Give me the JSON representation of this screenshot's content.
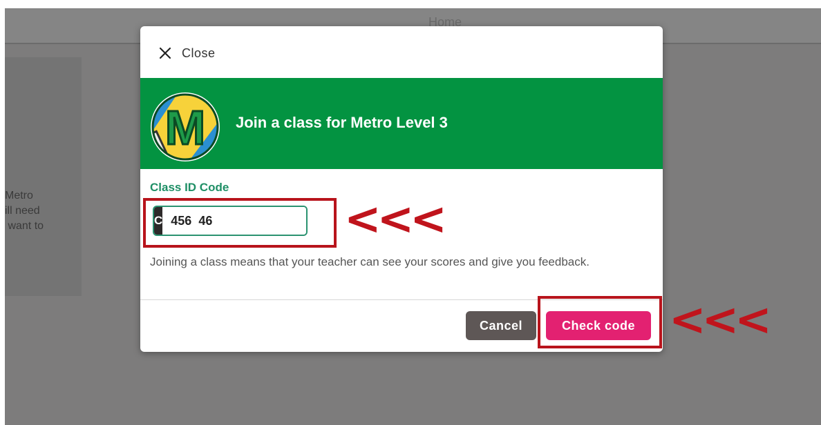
{
  "background": {
    "header_title": "Home",
    "card_text": "Metro\nill need\n want to"
  },
  "modal": {
    "close_label": "Close",
    "banner_title": "Join a class for Metro Level 3",
    "logo_letter": "M",
    "field_label": "Class ID Code",
    "code_prefix": "C",
    "code_value": "456  46",
    "help_text": "Joining a class means that your teacher can see your scores and give you feedback.",
    "cancel_label": "Cancel",
    "check_label": "Check code"
  },
  "annotations": {
    "arrow_text": "<<<"
  },
  "colors": {
    "banner_green": "#039341",
    "accent_pink": "#e32171",
    "annotation_red": "#b8141c",
    "label_teal": "#1f8f66"
  }
}
